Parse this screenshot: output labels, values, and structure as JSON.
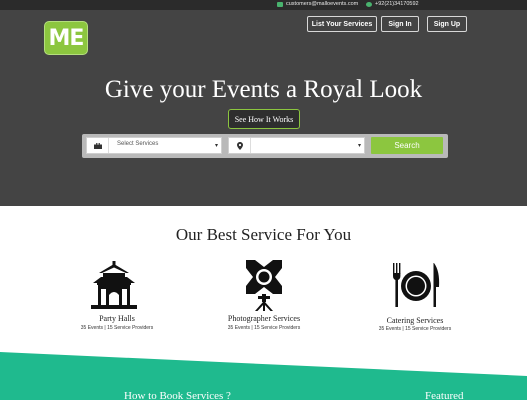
{
  "topbar": {
    "email": "customers@malloevents.com",
    "phone": "+92(21)34170592"
  },
  "header": {
    "logo_text": "ME",
    "nav": {
      "list_services": "List Your Services",
      "sign_in": "Sign In",
      "sign_up": "Sign Up"
    }
  },
  "hero": {
    "title": "Give your Events a Royal Look",
    "how_button": "See How It Works",
    "search": {
      "service_value": "Select Services",
      "location_value": "",
      "button": "Search"
    }
  },
  "services": {
    "title": "Our Best Service For You",
    "items": [
      {
        "name": "Party Halls",
        "stats": "35 Events | 15 Service Providers",
        "icon": "pagoda-icon"
      },
      {
        "name": "Photographer Services",
        "stats": "35 Events | 15 Service Providers",
        "icon": "camera-tripod-icon"
      },
      {
        "name": "Catering Services",
        "stats": "35 Events | 15 Service Providers",
        "icon": "fork-plate-knife-icon"
      }
    ]
  },
  "footer_band": {
    "left_heading": "How to Book Services ?",
    "right_heading": "Featured"
  },
  "colors": {
    "accent_green": "#8cc63f",
    "hero_bg": "#444444",
    "teal_band": "#1fba8e",
    "topbar_bg": "#2b2b2b"
  }
}
